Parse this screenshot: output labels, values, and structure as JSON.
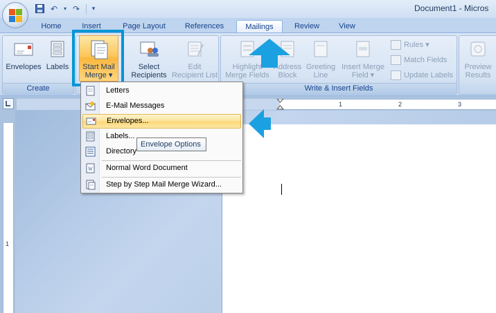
{
  "window": {
    "title": "Document1 - Micros"
  },
  "qat": {
    "undo_label": "↶",
    "redo_label": "↷"
  },
  "tabs": [
    {
      "label": "Home"
    },
    {
      "label": "Insert"
    },
    {
      "label": "Page Layout"
    },
    {
      "label": "References"
    },
    {
      "label": "Mailings"
    },
    {
      "label": "Review"
    },
    {
      "label": "View"
    }
  ],
  "active_tab": "Mailings",
  "ribbon": {
    "create": {
      "label": "Create",
      "envelopes": "Envelopes",
      "labels": "Labels"
    },
    "start": {
      "start_mail_merge_1": "Start Mail",
      "start_mail_merge_2": "Merge",
      "select_recipients_1": "Select",
      "select_recipients_2": "Recipients",
      "edit_recipient_1": "Edit",
      "edit_recipient_2": "Recipient List"
    },
    "write_insert": {
      "label": "Write & Insert Fields",
      "highlight_1": "Highlight",
      "highlight_2": "Merge Fields",
      "address_1": "Address",
      "address_2": "Block",
      "greeting_1": "Greeting",
      "greeting_2": "Line",
      "insert_merge_1": "Insert Merge",
      "insert_merge_2": "Field",
      "rules": "Rules",
      "match_fields": "Match Fields",
      "update_labels": "Update Labels"
    },
    "preview": {
      "preview_1": "Preview",
      "preview_2": "Results"
    }
  },
  "ruler": {
    "h_numbers": [
      "1",
      "2",
      "3"
    ],
    "v_numbers": [
      "1"
    ]
  },
  "menu": {
    "items": [
      {
        "label": "Letters"
      },
      {
        "label": "E-Mail Messages"
      },
      {
        "label": "Envelopes..."
      },
      {
        "label": "Labels..."
      },
      {
        "label": "Directory"
      },
      {
        "label": "Normal Word Document"
      },
      {
        "label": "Step by Step Mail Merge Wizard..."
      }
    ],
    "hovered": "Envelopes..."
  },
  "tooltip": {
    "text": "Envelope Options"
  },
  "colors": {
    "highlight_box": "#0096d6",
    "arrow": "#1ba1e2",
    "menu_hover": "#fcd676"
  }
}
